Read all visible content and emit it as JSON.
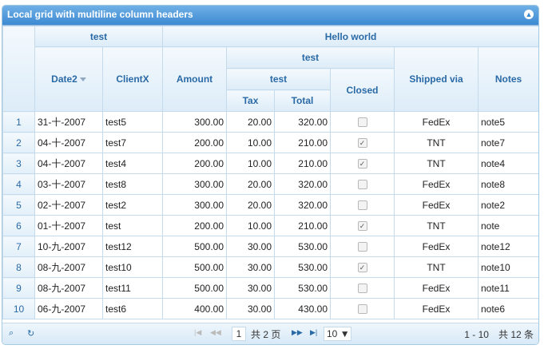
{
  "caption": "Local grid with multiline column headers",
  "headers": {
    "group_test": "test",
    "group_hello": "Hello world",
    "group_test2": "test",
    "group_test3": "test",
    "date": "Date2",
    "client": "ClientX",
    "amount": "Amount",
    "tax": "Tax",
    "total": "Total",
    "closed": "Closed",
    "ship": "Shipped via",
    "notes": "Notes"
  },
  "rows": [
    {
      "n": "1",
      "date": "31-十-2007",
      "client": "test5",
      "amount": "300.00",
      "tax": "20.00",
      "total": "320.00",
      "closed": false,
      "ship": "FedEx",
      "notes": "note5"
    },
    {
      "n": "2",
      "date": "04-十-2007",
      "client": "test7",
      "amount": "200.00",
      "tax": "10.00",
      "total": "210.00",
      "closed": true,
      "ship": "TNT",
      "notes": "note7"
    },
    {
      "n": "3",
      "date": "04-十-2007",
      "client": "test4",
      "amount": "200.00",
      "tax": "10.00",
      "total": "210.00",
      "closed": true,
      "ship": "TNT",
      "notes": "note4"
    },
    {
      "n": "4",
      "date": "03-十-2007",
      "client": "test8",
      "amount": "300.00",
      "tax": "20.00",
      "total": "320.00",
      "closed": false,
      "ship": "FedEx",
      "notes": "note8"
    },
    {
      "n": "5",
      "date": "02-十-2007",
      "client": "test2",
      "amount": "300.00",
      "tax": "20.00",
      "total": "320.00",
      "closed": false,
      "ship": "FedEx",
      "notes": "note2"
    },
    {
      "n": "6",
      "date": "01-十-2007",
      "client": "test",
      "amount": "200.00",
      "tax": "10.00",
      "total": "210.00",
      "closed": true,
      "ship": "TNT",
      "notes": "note"
    },
    {
      "n": "7",
      "date": "10-九-2007",
      "client": "test12",
      "amount": "500.00",
      "tax": "30.00",
      "total": "530.00",
      "closed": false,
      "ship": "FedEx",
      "notes": "note12"
    },
    {
      "n": "8",
      "date": "08-九-2007",
      "client": "test10",
      "amount": "500.00",
      "tax": "30.00",
      "total": "530.00",
      "closed": true,
      "ship": "TNT",
      "notes": "note10"
    },
    {
      "n": "9",
      "date": "08-九-2007",
      "client": "test11",
      "amount": "500.00",
      "tax": "30.00",
      "total": "530.00",
      "closed": false,
      "ship": "FedEx",
      "notes": "note11"
    },
    {
      "n": "10",
      "date": "06-九-2007",
      "client": "test6",
      "amount": "400.00",
      "tax": "30.00",
      "total": "430.00",
      "closed": false,
      "ship": "FedEx",
      "notes": "note6"
    }
  ],
  "pager": {
    "page": "1",
    "of_pages": "共 2 页",
    "rows_per_page": "10",
    "records": "1 - 10　共 12 条"
  },
  "icons": {
    "search": "search-icon",
    "refresh": "refresh-icon"
  }
}
